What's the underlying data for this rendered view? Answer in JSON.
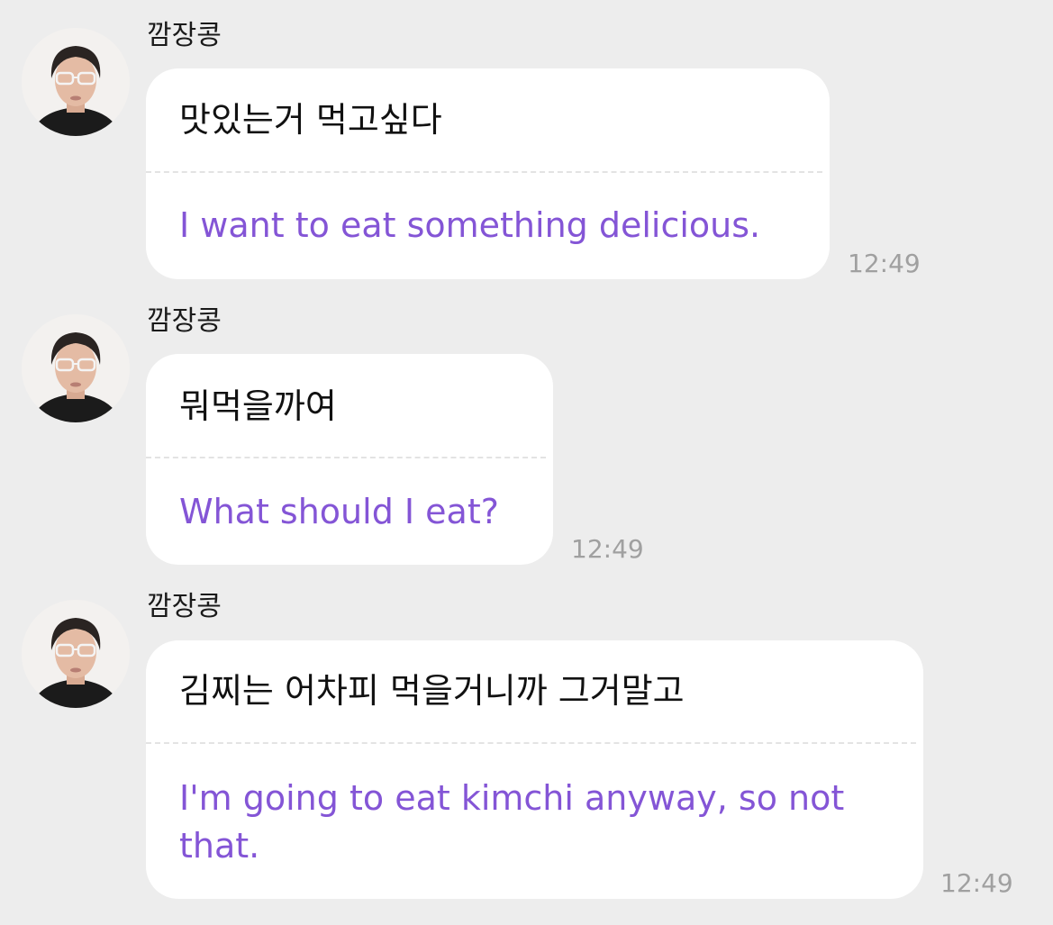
{
  "chat": {
    "messages": [
      {
        "sender": "깜장콩",
        "original": "맛있는거 먹고싶다",
        "translation": "I want to eat something delicious.",
        "time": "12:49"
      },
      {
        "sender": "깜장콩",
        "original": "뭐먹을까여",
        "translation": "What should I eat?",
        "time": "12:49"
      },
      {
        "sender": "깜장콩",
        "original": "김찌는 어차피 먹을거니까 그거말고",
        "translation": "I'm going to eat kimchi anyway, so not that.",
        "time": "12:49"
      }
    ]
  },
  "colors": {
    "background": "#ededed",
    "bubble": "#ffffff",
    "translation_text": "#8455d6",
    "timestamp": "#a0a0a0"
  }
}
